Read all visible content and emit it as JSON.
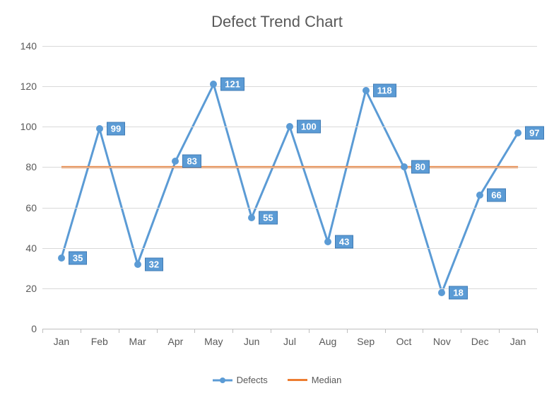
{
  "chart_data": {
    "type": "line",
    "title": "Defect Trend Chart",
    "xlabel": "",
    "ylabel": "",
    "ylim": [
      0,
      140
    ],
    "y_ticks": [
      0,
      20,
      40,
      60,
      80,
      100,
      120,
      140
    ],
    "categories": [
      "Jan",
      "Feb",
      "Mar",
      "Apr",
      "May",
      "Jun",
      "Jul",
      "Aug",
      "Sep",
      "Oct",
      "Nov",
      "Dec",
      "Jan"
    ],
    "series": [
      {
        "name": "Defects",
        "color": "#5b9bd5",
        "markers": true,
        "values": [
          35,
          99,
          32,
          83,
          121,
          55,
          100,
          43,
          118,
          80,
          18,
          66,
          97
        ]
      },
      {
        "name": "Median",
        "color": "#ed7d31",
        "markers": false,
        "values": [
          80,
          80,
          80,
          80,
          80,
          80,
          80,
          80,
          80,
          80,
          80,
          80,
          80
        ]
      }
    ],
    "legend": {
      "position": "bottom"
    }
  }
}
